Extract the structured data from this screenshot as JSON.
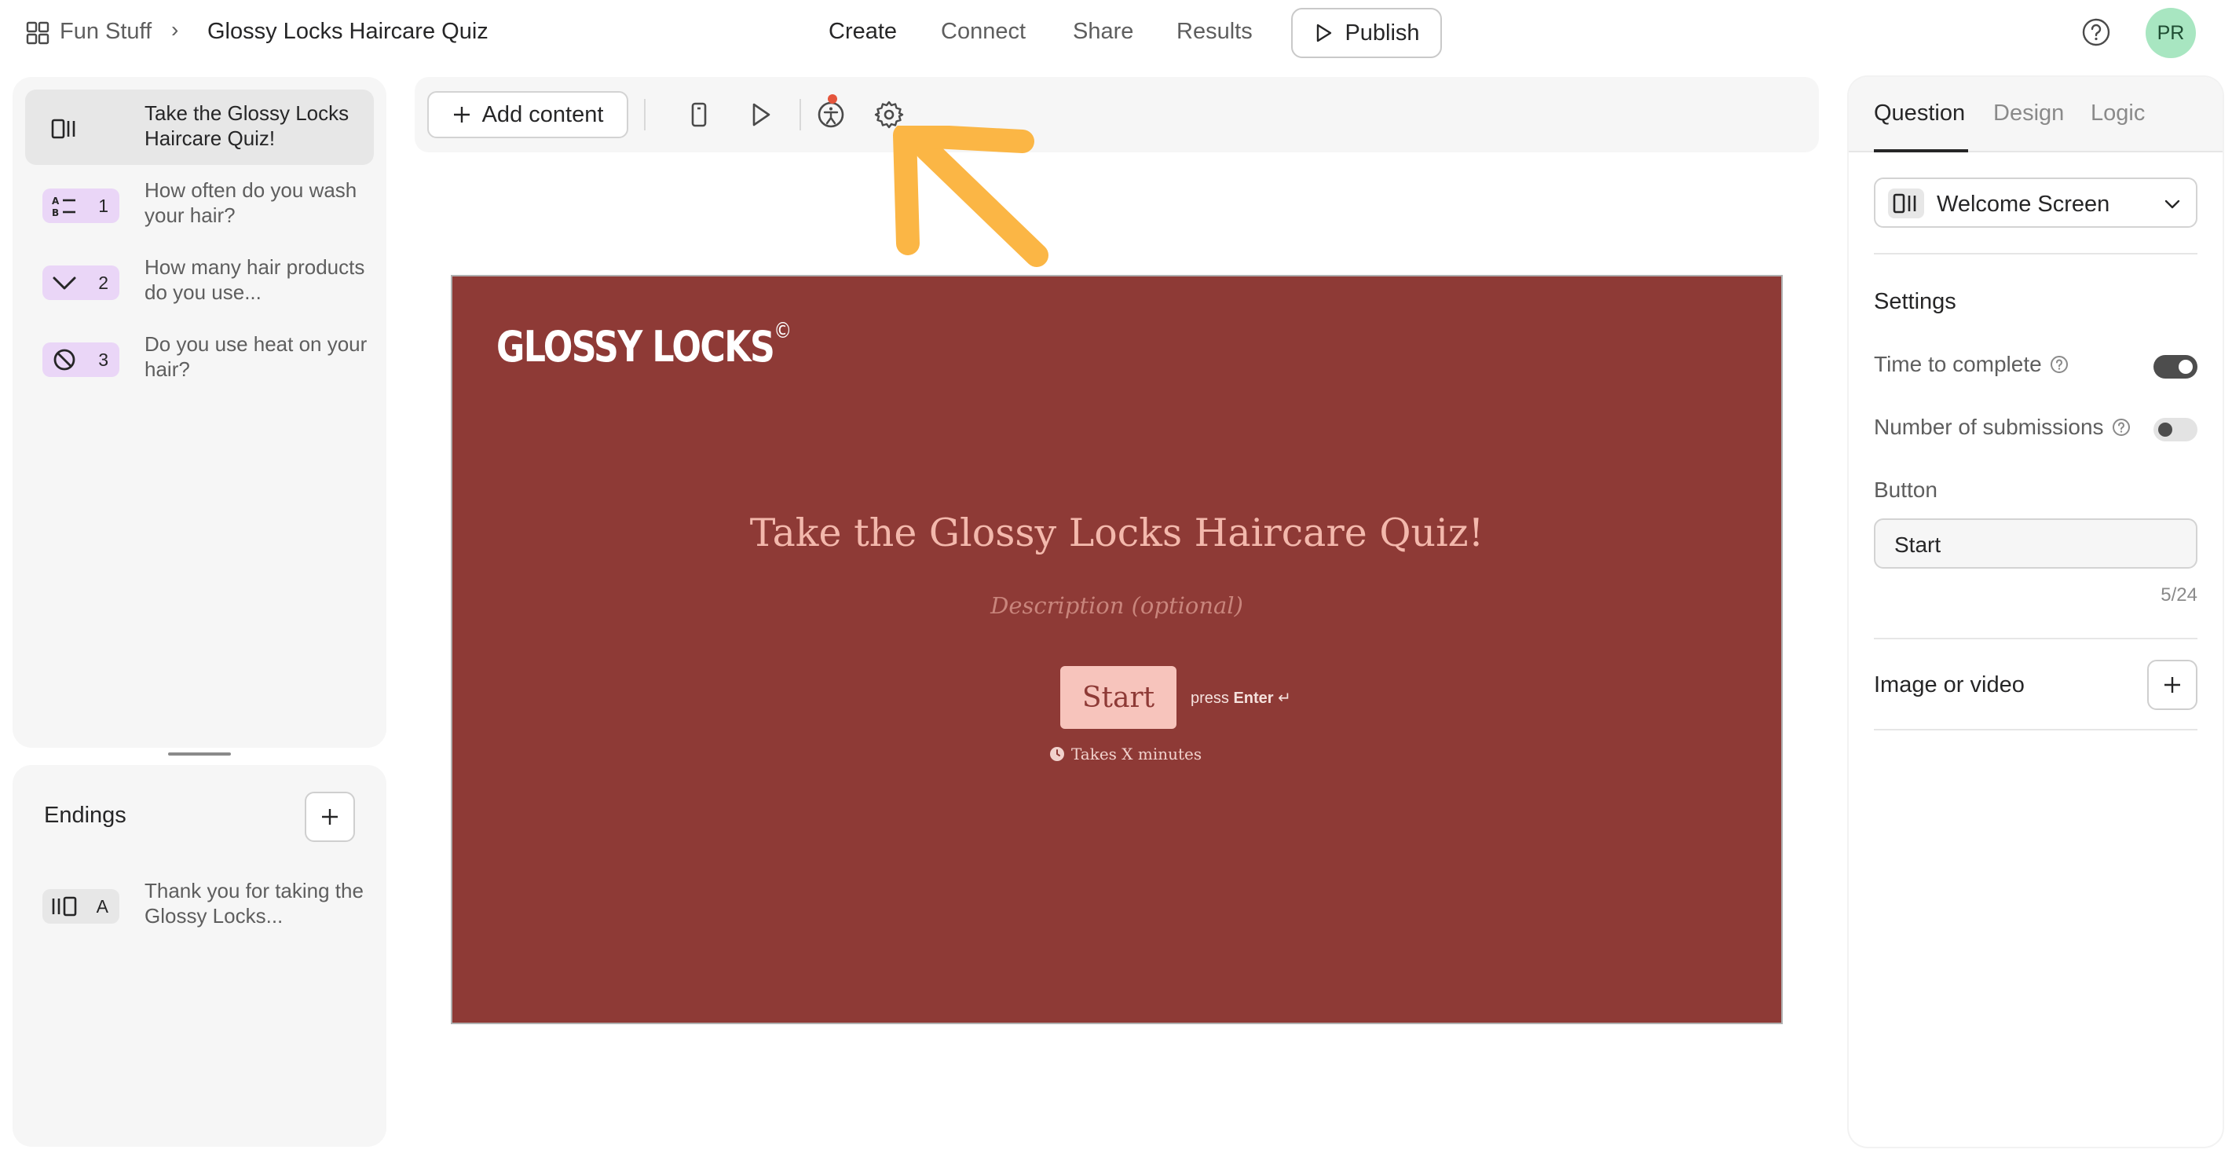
{
  "breadcrumb": {
    "parent": "Fun Stuff",
    "separator": "›",
    "current": "Glossy Locks Haircare Quiz"
  },
  "nav": {
    "create": "Create",
    "connect": "Connect",
    "share": "Share",
    "results": "Results",
    "publish": "Publish"
  },
  "user": {
    "initials": "PR",
    "avatar_color": "#a8e6c1"
  },
  "questions": [
    {
      "number": "",
      "label": "Take the Glossy Locks Haircare Quiz!",
      "icon": "welcome-screen-icon",
      "badge_color": "#e7e7e7"
    },
    {
      "number": "1",
      "label": "How often do you wash your hair?",
      "icon": "multiple-choice-icon",
      "badge_color": "#ead6f7"
    },
    {
      "number": "2",
      "label": "How many hair products do you use...",
      "icon": "dropdown-icon",
      "badge_color": "#ead6f7"
    },
    {
      "number": "3",
      "label": "Do you use heat on your hair?",
      "icon": "yes-no-icon",
      "badge_color": "#ead6f7"
    }
  ],
  "endings": {
    "title": "Endings",
    "items": [
      {
        "letter": "A",
        "label": "Thank you for taking the Glossy Locks..."
      }
    ]
  },
  "toolbar": {
    "add_content": "Add content"
  },
  "canvas": {
    "brand": "GLOSSY LOCKS",
    "brand_mark": "©",
    "title": "Take the Glossy Locks Haircare Quiz!",
    "description_placeholder": "Description (optional)",
    "start_button": "Start",
    "press_text": "press",
    "enter_text": "Enter",
    "enter_glyph": "↵",
    "takes_time": "Takes X minutes",
    "background_color": "#8e3a36",
    "title_color": "#f3b8ac",
    "button_color": "#f7c4bc"
  },
  "annotation": {
    "arrow_color": "#fbb645"
  },
  "right_panel": {
    "tabs": [
      "Question",
      "Design",
      "Logic"
    ],
    "active_tab": "Question",
    "question_type": "Welcome Screen",
    "settings_heading": "Settings",
    "time_to_complete": "Time to complete",
    "time_to_complete_on": true,
    "number_of_submissions": "Number of submissions",
    "number_of_submissions_on": false,
    "button_heading": "Button",
    "button_value": "Start",
    "button_char_count": "5/24",
    "image_or_video": "Image or video"
  }
}
